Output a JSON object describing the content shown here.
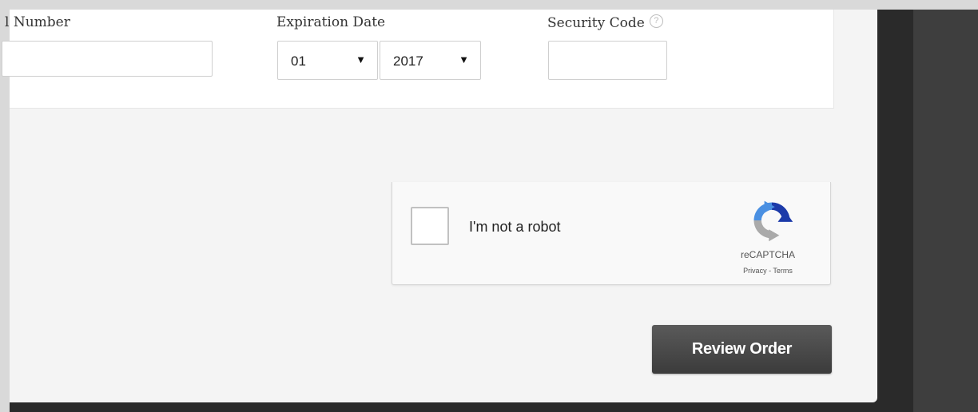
{
  "payment_form": {
    "card_number_label": "l Number",
    "card_number_value": "",
    "expiration_label": "Expiration Date",
    "expiration_month": "01",
    "expiration_year": "2017",
    "security_code_label": "Security Code",
    "security_code_value": "",
    "help_icon_glyph": "?"
  },
  "recaptcha": {
    "label": "I'm not a robot",
    "brand": "reCAPTCHA",
    "privacy_link": "Privacy",
    "separator": " - ",
    "terms_link": "Terms",
    "checked": false
  },
  "actions": {
    "review_order_label": "Review Order"
  },
  "icons": {
    "select_arrow": "▼",
    "help": "question-circle-icon",
    "recaptcha_logo": "recaptcha-logo-icon"
  },
  "colors": {
    "panel_background": "#f4f4f4",
    "page_background": "#2a2a2a",
    "button_background": "#4a4a4a",
    "recaptcha_blue": "#1c3aa9",
    "recaptcha_lightblue": "#4a90e2",
    "recaptcha_gray": "#aaaaaa"
  }
}
